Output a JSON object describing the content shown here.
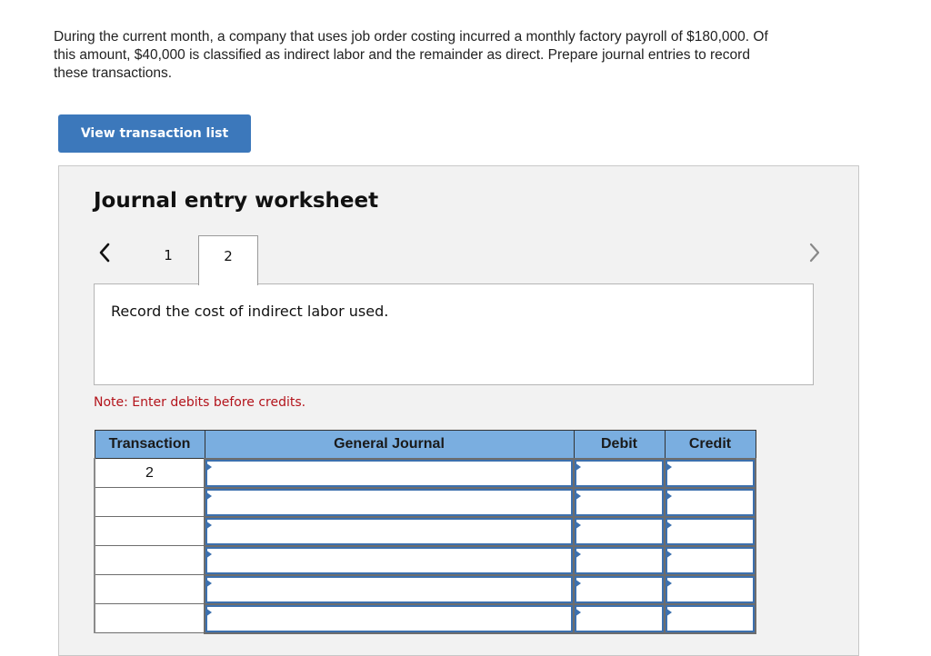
{
  "problem": {
    "text": "During the current month, a company that uses job order costing incurred a monthly factory payroll of $180,000. Of this amount, $40,000 is classified as indirect labor and the remainder as direct. Prepare journal entries to record these transactions."
  },
  "view_transaction_button": {
    "label": "View transaction list"
  },
  "worksheet": {
    "title": "Journal entry worksheet",
    "nav": {
      "prev_icon": "chevron-left-icon",
      "next_icon": "chevron-right-icon"
    },
    "tabs": [
      {
        "label": "1",
        "active": false
      },
      {
        "label": "2",
        "active": true
      }
    ],
    "description": "Record the cost of indirect labor used.",
    "note": "Note: Enter debits before credits.",
    "table": {
      "headers": {
        "transaction": "Transaction",
        "general_journal": "General Journal",
        "debit": "Debit",
        "credit": "Credit"
      },
      "rows": [
        {
          "transaction": "2",
          "account": "",
          "debit": "",
          "credit": ""
        },
        {
          "transaction": "",
          "account": "",
          "debit": "",
          "credit": ""
        },
        {
          "transaction": "",
          "account": "",
          "debit": "",
          "credit": ""
        },
        {
          "transaction": "",
          "account": "",
          "debit": "",
          "credit": ""
        },
        {
          "transaction": "",
          "account": "",
          "debit": "",
          "credit": ""
        },
        {
          "transaction": "",
          "account": "",
          "debit": "",
          "credit": ""
        }
      ]
    }
  },
  "colors": {
    "button_blue": "#3c78bb",
    "header_blue": "#7aaee0",
    "input_border_blue": "#3c70ae",
    "note_red": "#b3131b",
    "panel_gray": "#f2f2f2"
  }
}
